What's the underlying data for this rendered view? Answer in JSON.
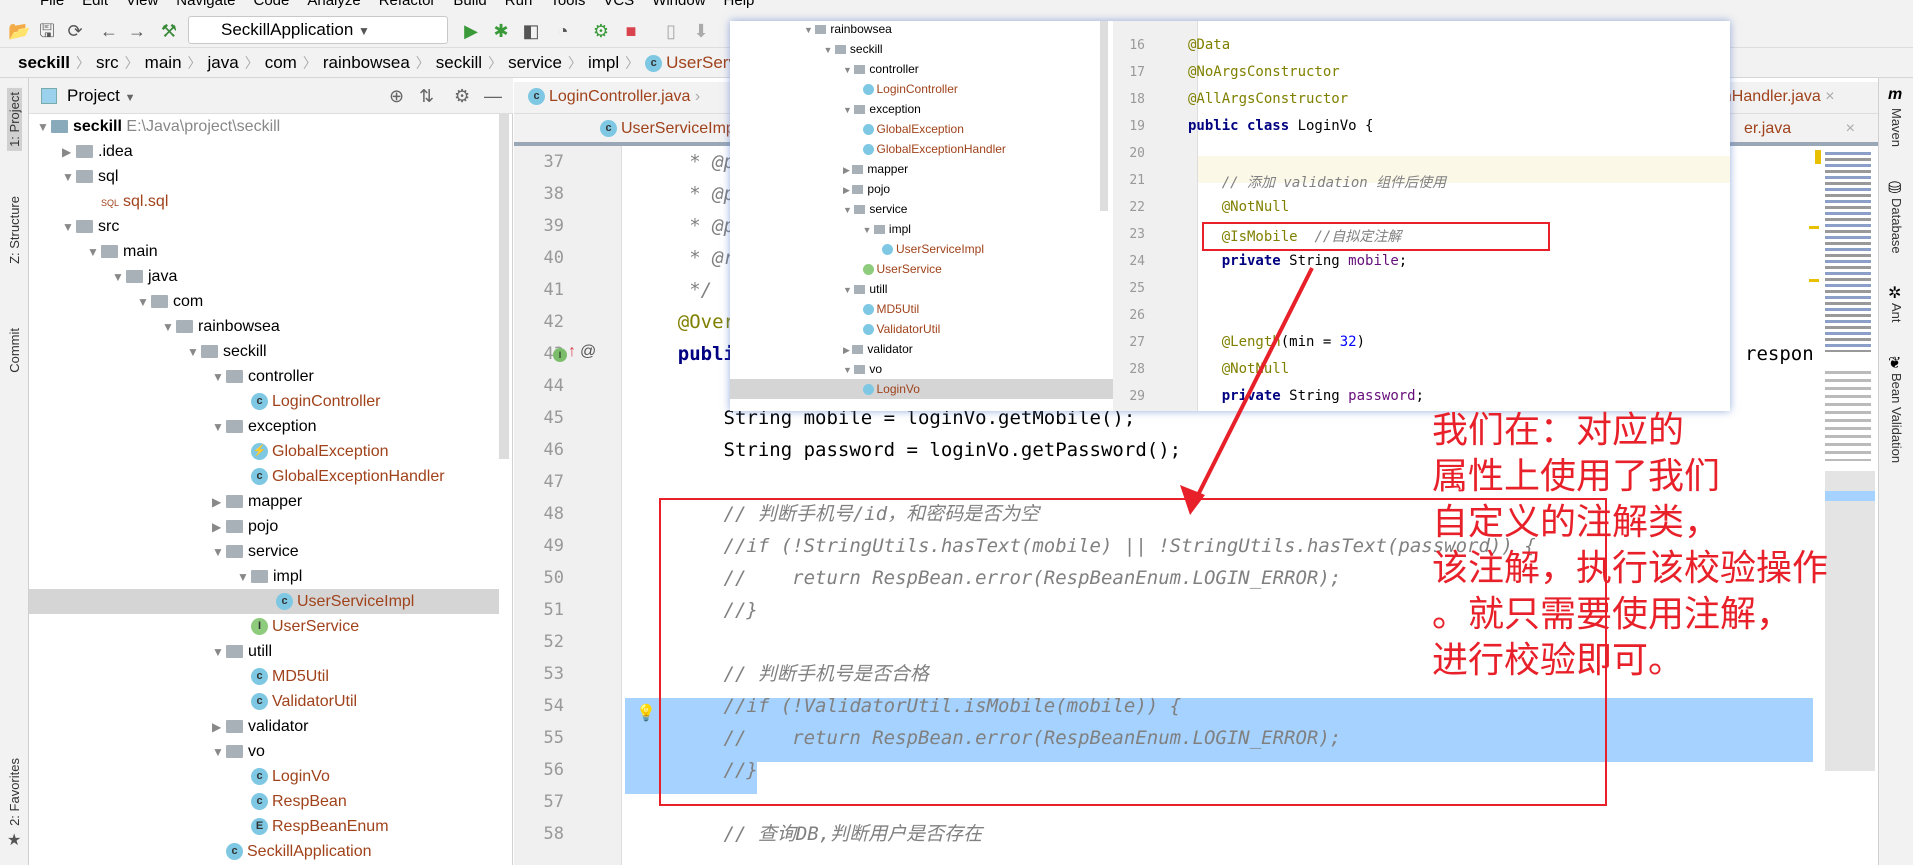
{
  "menu": [
    "File",
    "Edit",
    "View",
    "Navigate",
    "Code",
    "Analyze",
    "Refactor",
    "Build",
    "Run",
    "Tools",
    "VCS",
    "Window",
    "Help"
  ],
  "toolbar": {
    "run_config": "SeckillApplication"
  },
  "breadcrumb": [
    "seckill",
    "src",
    "main",
    "java",
    "com",
    "rainbowsea",
    "seckill",
    "service",
    "impl",
    "UserServiceImpl"
  ],
  "left_strip": {
    "project": "1: Project",
    "structure": "Z: Structure",
    "commit": "Commit",
    "favorites": "2: Favorites"
  },
  "right_strip": {
    "maven": "Maven",
    "database": "Database",
    "ant": "Ant",
    "bean": "Bean Validation"
  },
  "project_panel": {
    "title": "Project",
    "root": {
      "name": "seckill",
      "path": "E:\\Java\\project\\seckill"
    },
    "tree": [
      {
        "d": 1,
        "t": "folder",
        "n": ".idea",
        "exp": false
      },
      {
        "d": 1,
        "t": "folder",
        "n": "sql",
        "exp": true
      },
      {
        "d": 2,
        "t": "sql",
        "n": "sql.sql"
      },
      {
        "d": 1,
        "t": "folder",
        "n": "src",
        "exp": true
      },
      {
        "d": 2,
        "t": "folder",
        "n": "main",
        "exp": true
      },
      {
        "d": 3,
        "t": "folder",
        "n": "java",
        "exp": true
      },
      {
        "d": 4,
        "t": "folder",
        "n": "com",
        "exp": true
      },
      {
        "d": 5,
        "t": "folder",
        "n": "rainbowsea",
        "exp": true
      },
      {
        "d": 6,
        "t": "folder",
        "n": "seckill",
        "exp": true
      },
      {
        "d": 7,
        "t": "folder",
        "n": "controller",
        "exp": true
      },
      {
        "d": 8,
        "t": "c",
        "n": "LoginController"
      },
      {
        "d": 7,
        "t": "folder",
        "n": "exception",
        "exp": true
      },
      {
        "d": 8,
        "t": "x",
        "n": "GlobalException"
      },
      {
        "d": 8,
        "t": "c",
        "n": "GlobalExceptionHandler"
      },
      {
        "d": 7,
        "t": "folder",
        "n": "mapper",
        "exp": false
      },
      {
        "d": 7,
        "t": "folder",
        "n": "pojo",
        "exp": false
      },
      {
        "d": 7,
        "t": "folder",
        "n": "service",
        "exp": true
      },
      {
        "d": 8,
        "t": "folder",
        "n": "impl",
        "exp": true
      },
      {
        "d": 9,
        "t": "c",
        "n": "UserServiceImpl",
        "sel": true
      },
      {
        "d": 8,
        "t": "i",
        "n": "UserService"
      },
      {
        "d": 7,
        "t": "folder",
        "n": "utill",
        "exp": true
      },
      {
        "d": 8,
        "t": "c",
        "n": "MD5Util"
      },
      {
        "d": 8,
        "t": "c",
        "n": "ValidatorUtil"
      },
      {
        "d": 7,
        "t": "folder",
        "n": "validator",
        "exp": false
      },
      {
        "d": 7,
        "t": "folder",
        "n": "vo",
        "exp": true
      },
      {
        "d": 8,
        "t": "c",
        "n": "LoginVo"
      },
      {
        "d": 8,
        "t": "c",
        "n": "RespBean"
      },
      {
        "d": 8,
        "t": "e",
        "n": "RespBeanEnum"
      },
      {
        "d": 7,
        "t": "c",
        "n": "SeckillApplication"
      }
    ]
  },
  "tabs": {
    "row1": [
      "LoginController.java",
      "onHandler.java"
    ],
    "row2": [
      "UserServiceImpl",
      "er.java"
    ]
  },
  "editor": {
    "lines": [
      {
        "n": 37,
        "html": [
          [
            "cm",
            "     * @p"
          ]
        ]
      },
      {
        "n": 38,
        "html": [
          [
            "cm",
            "     * @p"
          ]
        ]
      },
      {
        "n": 39,
        "html": [
          [
            "cm",
            "     * @p"
          ]
        ]
      },
      {
        "n": 40,
        "html": [
          [
            "cm",
            "     * @r"
          ]
        ]
      },
      {
        "n": 41,
        "html": [
          [
            "cm",
            "     */"
          ]
        ]
      },
      {
        "n": 42,
        "html": [
          [
            "ann",
            "    @Over"
          ]
        ]
      },
      {
        "n": 43,
        "html": [
          [
            "kw",
            "    publi"
          ]
        ]
      },
      {
        "n": 44,
        "html": []
      },
      {
        "n": 45,
        "html": [
          [
            "",
            "        String mobile = loginVo.getMobile();"
          ]
        ]
      },
      {
        "n": 46,
        "html": [
          [
            "",
            "        String password = loginVo.getPassword();"
          ]
        ]
      },
      {
        "n": 47,
        "html": []
      },
      {
        "n": 48,
        "html": [
          [
            "cm",
            "        // 判断手机号/id，和密码是否为空"
          ]
        ]
      },
      {
        "n": 49,
        "html": [
          [
            "cm",
            "        //if (!StringUtils.hasText(mobile) || !StringUtils.hasText(password)) {"
          ]
        ]
      },
      {
        "n": 50,
        "html": [
          [
            "cm",
            "        //    return RespBean.error(RespBeanEnum.LOGIN_ERROR);"
          ]
        ]
      },
      {
        "n": 51,
        "html": [
          [
            "cm",
            "        //}"
          ]
        ]
      },
      {
        "n": 52,
        "html": []
      },
      {
        "n": 53,
        "html": [
          [
            "cm",
            "        // 判断手机号是否合格"
          ]
        ]
      },
      {
        "n": 54,
        "html": [
          [
            "cm",
            "        //if (!ValidatorUtil.isMobile(mobile)) {"
          ]
        ]
      },
      {
        "n": 55,
        "html": [
          [
            "cm",
            "        //    return RespBean.error(RespBeanEnum.LOGIN_ERROR);"
          ]
        ]
      },
      {
        "n": 56,
        "html": [
          [
            "cm",
            "        //}"
          ]
        ]
      },
      {
        "n": 57,
        "html": []
      },
      {
        "n": 58,
        "html": [
          [
            "cm",
            "        // 查询DB,判断用户是否存在"
          ]
        ]
      }
    ],
    "line43_tail": "respon"
  },
  "popup": {
    "tree": [
      {
        "d": 0,
        "t": "folder",
        "n": "rainbowsea"
      },
      {
        "d": 1,
        "t": "folder",
        "n": "seckill"
      },
      {
        "d": 2,
        "t": "folder",
        "n": "controller"
      },
      {
        "d": 3,
        "t": "c",
        "n": "LoginController"
      },
      {
        "d": 2,
        "t": "folder",
        "n": "exception"
      },
      {
        "d": 3,
        "t": "x",
        "n": "GlobalException"
      },
      {
        "d": 3,
        "t": "c",
        "n": "GlobalExceptionHandler"
      },
      {
        "d": 2,
        "t": "folder",
        "n": "mapper",
        "col": true
      },
      {
        "d": 2,
        "t": "folder",
        "n": "pojo",
        "col": true
      },
      {
        "d": 2,
        "t": "folder",
        "n": "service"
      },
      {
        "d": 3,
        "t": "folder",
        "n": "impl"
      },
      {
        "d": 4,
        "t": "c",
        "n": "UserServiceImpl"
      },
      {
        "d": 3,
        "t": "i",
        "n": "UserService"
      },
      {
        "d": 2,
        "t": "folder",
        "n": "utill"
      },
      {
        "d": 3,
        "t": "c",
        "n": "MD5Util"
      },
      {
        "d": 3,
        "t": "c",
        "n": "ValidatorUtil"
      },
      {
        "d": 2,
        "t": "folder",
        "n": "validator",
        "col": true
      },
      {
        "d": 2,
        "t": "folder",
        "n": "vo"
      },
      {
        "d": 3,
        "t": "c",
        "n": "LoginVo",
        "sel": true
      }
    ],
    "lines": [
      {
        "n": 16,
        "html": [
          [
            "ann",
            "@Data"
          ]
        ]
      },
      {
        "n": 17,
        "html": [
          [
            "ann",
            "@NoArgsConstructor"
          ]
        ]
      },
      {
        "n": 18,
        "html": [
          [
            "ann",
            "@AllArgsConstructor"
          ]
        ]
      },
      {
        "n": 19,
        "html": [
          [
            "kw",
            "public class "
          ],
          [
            "",
            "LoginVo {"
          ]
        ]
      },
      {
        "n": 20,
        "html": []
      },
      {
        "n": 21,
        "html": [
          [
            "cm",
            "    // 添加 validation 组件后使用"
          ]
        ]
      },
      {
        "n": 22,
        "html": [
          [
            "ann",
            "    @NotNull"
          ]
        ]
      },
      {
        "n": 23,
        "html": [
          [
            "ann",
            "    @IsMobile  "
          ],
          [
            "cm",
            "//自拟定注解"
          ]
        ]
      },
      {
        "n": 24,
        "html": [
          [
            "kw",
            "    private "
          ],
          [
            "",
            "String "
          ],
          [
            "fld",
            "mobile"
          ],
          [
            "",
            ";"
          ]
        ]
      },
      {
        "n": 25,
        "html": []
      },
      {
        "n": 26,
        "html": []
      },
      {
        "n": 27,
        "html": [
          [
            "ann",
            "    @Length"
          ],
          [
            "",
            "(min = "
          ],
          [
            "num",
            "32"
          ],
          [
            "",
            ")"
          ]
        ]
      },
      {
        "n": 28,
        "html": [
          [
            "ann",
            "    @NotNull"
          ]
        ]
      },
      {
        "n": 29,
        "html": [
          [
            "kw",
            "    private "
          ],
          [
            "",
            "String "
          ],
          [
            "fld",
            "password"
          ],
          [
            "",
            ";"
          ]
        ]
      }
    ]
  },
  "annotation_note": "我们在：对应的\n属性上使用了我们\n自定义的注解类，\n该注解，执行该校验操作\n。就只需要使用注解，\n进行校验即可。",
  "colors": {
    "annotation_red": "#e8202a",
    "selection": "#a6d2ff",
    "class_name": "#a0421b"
  }
}
